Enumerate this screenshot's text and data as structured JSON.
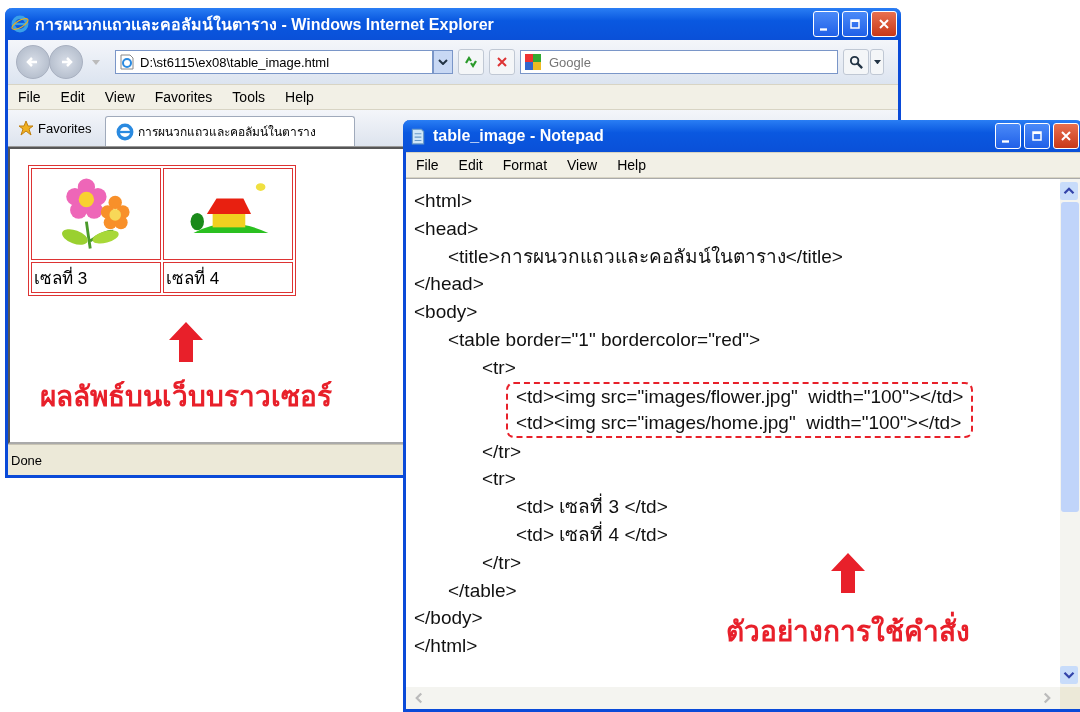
{
  "browser": {
    "title": "การผนวกแถวและคอลัมน์ในตาราง - Windows Internet Explorer",
    "address": "D:\\st6115\\ex08\\table_image.html",
    "search": {
      "placeholder": "Google"
    },
    "menu": [
      "File",
      "Edit",
      "View",
      "Favorites",
      "Tools",
      "Help"
    ],
    "favorites": "Favorites",
    "tab": "การผนวกแถวและคอลัมน์ในตาราง",
    "image_cells": [
      {
        "kind": "flower"
      },
      {
        "kind": "house"
      }
    ],
    "text_cells": [
      "เซลที่ 3",
      "เซลที่ 4"
    ],
    "annotation": "ผลลัพธ์บนเว็บบราวเซอร์",
    "status": "Done"
  },
  "notepad": {
    "title": "table_image - Notepad",
    "menu": [
      "File",
      "Edit",
      "Format",
      "View",
      "Help"
    ],
    "code": [
      {
        "text": "<html>",
        "highlighted": false
      },
      {
        "text": "<head>",
        "highlighted": false,
        "children": [
          {
            "text": "<title>การผนวกแถวและคอลัมน์ในตาราง</title>",
            "highlighted": false
          }
        ]
      },
      {
        "text": "</head>",
        "highlighted": false
      },
      {
        "text": "<body>",
        "highlighted": false,
        "children": [
          {
            "text": "<table border=\"1\" bordercolor=\"red\">",
            "highlighted": false,
            "children": [
              {
                "text": "<tr>",
                "highlighted": false,
                "children": [
                  {
                    "text": "<td><img src=\"images/flower.jpg\"  width=\"100\"></td>",
                    "highlighted": true
                  },
                  {
                    "text": "<td><img src=\"images/home.jpg\"  width=\"100\"></td>",
                    "highlighted": true
                  }
                ]
              },
              {
                "text": "</tr>",
                "highlighted": false
              },
              {
                "text": "<tr>",
                "highlighted": false,
                "children": [
                  {
                    "text": "<td> เซลที่ 3 </td>",
                    "highlighted": false
                  },
                  {
                    "text": "<td> เซลที่ 4 </td>",
                    "highlighted": false
                  }
                ]
              },
              {
                "text": "</tr>",
                "highlighted": false
              }
            ]
          },
          {
            "text": "</table>",
            "highlighted": false
          }
        ]
      },
      {
        "text": "</body>",
        "highlighted": false
      },
      {
        "text": "</html>",
        "highlighted": false
      }
    ],
    "annotation": "ตัวอย่างการใช้คำสั่ง"
  }
}
